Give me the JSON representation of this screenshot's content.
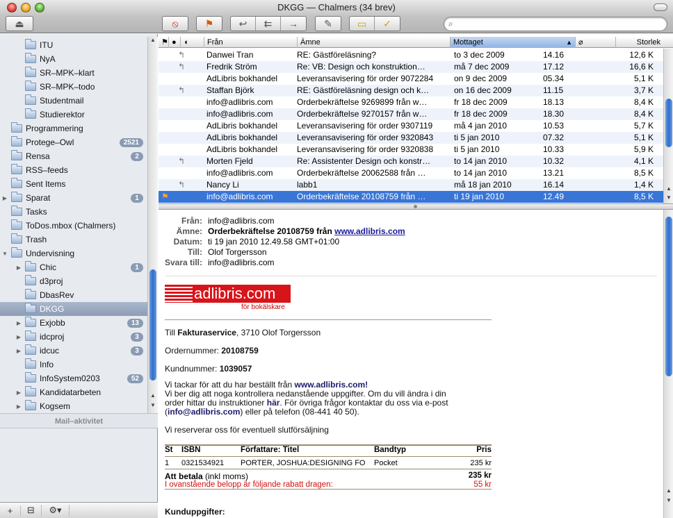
{
  "window": {
    "title": "DKGG — Chalmers (34 brev)"
  },
  "toolbar": {
    "search_placeholder": ""
  },
  "sidebar": {
    "items": [
      {
        "label": "ITU",
        "badge": "",
        "indent": 2,
        "tri": "",
        "sel": false
      },
      {
        "label": "NyA",
        "badge": "",
        "indent": 2,
        "tri": "",
        "sel": false
      },
      {
        "label": "SR–MPK–klart",
        "badge": "",
        "indent": 2,
        "tri": "",
        "sel": false
      },
      {
        "label": "SR–MPK–todo",
        "badge": "",
        "indent": 2,
        "tri": "",
        "sel": false
      },
      {
        "label": "Studentmail",
        "badge": "",
        "indent": 2,
        "tri": "",
        "sel": false
      },
      {
        "label": "Studierektor",
        "badge": "",
        "indent": 2,
        "tri": "",
        "sel": false
      },
      {
        "label": "Programmering",
        "badge": "",
        "indent": 1,
        "tri": "",
        "sel": false
      },
      {
        "label": "Protege–Owl",
        "badge": "2521",
        "indent": 1,
        "tri": "",
        "sel": false
      },
      {
        "label": "Rensa",
        "badge": "2",
        "indent": 1,
        "tri": "",
        "sel": false
      },
      {
        "label": "RSS–feeds",
        "badge": "",
        "indent": 1,
        "tri": "",
        "sel": false
      },
      {
        "label": "Sent Items",
        "badge": "",
        "indent": 1,
        "tri": "",
        "sel": false
      },
      {
        "label": "Sparat",
        "badge": "1",
        "indent": 1,
        "tri": "▶",
        "sel": false
      },
      {
        "label": "Tasks",
        "badge": "",
        "indent": 1,
        "tri": "",
        "sel": false
      },
      {
        "label": "ToDos.mbox (Chalmers)",
        "badge": "",
        "indent": 1,
        "tri": "",
        "sel": false
      },
      {
        "label": "Trash",
        "badge": "",
        "indent": 1,
        "tri": "",
        "sel": false
      },
      {
        "label": "Undervisning",
        "badge": "",
        "indent": 1,
        "tri": "▼",
        "sel": false
      },
      {
        "label": "Chic",
        "badge": "1",
        "indent": 2,
        "tri": "▶",
        "sel": false
      },
      {
        "label": "d3proj",
        "badge": "",
        "indent": 2,
        "tri": "",
        "sel": false
      },
      {
        "label": "DbasRev",
        "badge": "",
        "indent": 2,
        "tri": "",
        "sel": false
      },
      {
        "label": "DKGG",
        "badge": "",
        "indent": 2,
        "tri": "",
        "sel": true
      },
      {
        "label": "Exjobb",
        "badge": "13",
        "indent": 2,
        "tri": "▶",
        "sel": false
      },
      {
        "label": "idcproj",
        "badge": "3",
        "indent": 2,
        "tri": "▶",
        "sel": false
      },
      {
        "label": "idcuc",
        "badge": "3",
        "indent": 2,
        "tri": "▶",
        "sel": false
      },
      {
        "label": "Info",
        "badge": "",
        "indent": 2,
        "tri": "",
        "sel": false
      },
      {
        "label": "InfoSystem0203",
        "badge": "52",
        "indent": 2,
        "tri": "",
        "sel": false
      },
      {
        "label": "Kandidatarbeten",
        "badge": "",
        "indent": 2,
        "tri": "▶",
        "sel": false
      },
      {
        "label": "Kogsem",
        "badge": "",
        "indent": 2,
        "tri": "▶",
        "sel": false
      }
    ],
    "activity_label": "Mail–aktivitet"
  },
  "list": {
    "columns": {
      "from": "Från",
      "subject": "Ämne",
      "received": "Mottaget",
      "size": "Storlek"
    },
    "rows": [
      {
        "icon": "↰",
        "from": "Danwei Tran",
        "subject": "RE: Gästföreläsning?",
        "date": "to 3 dec 2009",
        "time": "14.16",
        "size": "12,6 K"
      },
      {
        "icon": "↰",
        "from": "Fredrik Ström",
        "subject": "Re: VB: Design och konstruktion…",
        "date": "må 7 dec 2009",
        "time": "17.12",
        "size": "16,6 K"
      },
      {
        "icon": "",
        "from": "AdLibris bokhandel",
        "subject": "Leveransavisering för order 9072284",
        "date": "on 9 dec 2009",
        "time": "05.34",
        "size": "5,1 K"
      },
      {
        "icon": "↰",
        "from": "Staffan Björk",
        "subject": "RE: Gästföreläsning design och k…",
        "date": "on 16 dec 2009",
        "time": "11.15",
        "size": "3,7 K"
      },
      {
        "icon": "",
        "from": "info@adlibris.com",
        "subject": "Orderbekräftelse 9269899 från w…",
        "date": "fr 18 dec 2009",
        "time": "18.13",
        "size": "8,4 K"
      },
      {
        "icon": "",
        "from": "info@adlibris.com",
        "subject": "Orderbekräftelse 9270157 från w…",
        "date": "fr 18 dec 2009",
        "time": "18.30",
        "size": "8,4 K"
      },
      {
        "icon": "",
        "from": "AdLibris bokhandel",
        "subject": "Leveransavisering för order 9307119",
        "date": "må 4 jan 2010",
        "time": "10.53",
        "size": "5,7 K"
      },
      {
        "icon": "",
        "from": "AdLibris bokhandel",
        "subject": "Leveransavisering för order 9320843",
        "date": "ti 5 jan 2010",
        "time": "07.32",
        "size": "5,1 K"
      },
      {
        "icon": "",
        "from": "AdLibris bokhandel",
        "subject": "Leveransavisering för order 9320838",
        "date": "ti 5 jan 2010",
        "time": "10.33",
        "size": "5,9 K"
      },
      {
        "icon": "↰",
        "from": "Morten Fjeld",
        "subject": "Re: Assistenter Design och konstr…",
        "date": "to 14 jan 2010",
        "time": "10.32",
        "size": "4,1 K"
      },
      {
        "icon": "",
        "from": "info@adlibris.com",
        "subject": "Orderbekräftelse 20062588 från …",
        "date": "to 14 jan 2010",
        "time": "13.21",
        "size": "8,5 K"
      },
      {
        "icon": "↰",
        "from": "Nancy Li",
        "subject": "labb1",
        "date": "må 18 jan 2010",
        "time": "16.14",
        "size": "1,4 K"
      },
      {
        "icon": "⚑",
        "from": "info@adlibris.com",
        "subject": "Orderbekräftelse 20108759 från …",
        "date": "ti 19 jan 2010",
        "time": "12.49",
        "size": "8,5 K"
      }
    ]
  },
  "message": {
    "headers": {
      "from_k": "Från:",
      "from_v": "info@adlibris.com",
      "subj_k": "Ämne:",
      "subj_v": "Orderbekräftelse 20108759 från ",
      "subj_link": "www.adlibris.com",
      "date_k": "Datum:",
      "date_v": "ti 19 jan 2010 12.49.58 GMT+01:00",
      "to_k": "Till:",
      "to_v": "Olof Torgersson",
      "reply_k": "Svara till:",
      "reply_v": "info@adlibris.com"
    },
    "logo": {
      "text": "adlibris.com",
      "tagline": "för bokälskare"
    },
    "body": {
      "l1a": "Till ",
      "l1b": "Fakturaservice",
      ", l1c": "",
      "l1rest": ", 3710 Olof Torgersson",
      "order_k": "Ordernummer: ",
      "order_v": "20108759",
      "cust_k": "Kundnummer: ",
      "cust_v": "1039057",
      "p1a": "Vi tackar för att du har beställt från ",
      "p1b": "www.adlibris.com",
      "p1c": "!",
      "p2": "Vi ber dig att noga kontrollera nedanstående uppgifter. Om du vill ändra i din",
      "p3a": "order hittar du instruktioner ",
      "p3b": "här",
      ". p3c": "",
      "p3rest": ". För övriga frågor kontaktar du oss via e-post",
      "p4a": "(",
      "p4b": "info@adlibris.com",
      "p4c": ") eller på telefon (08-441 40 50).",
      "p5": "Vi reserverar oss för eventuell slutförsäljning",
      "table": {
        "h_st": "St",
        "h_isbn": "ISBN",
        "h_auth": "Författare: Titel",
        "h_band": "Bandtyp",
        "h_price": "Pris",
        "r_st": "1",
        "r_isbn": "0321534921",
        "r_auth": "PORTER, JOSHUA:DESIGNING FO",
        "r_band": "Pocket",
        "r_price": "235 kr",
        "tot_k": "Att betala",
        "tot_k2": " (inkl moms)",
        "tot_v": "235 kr",
        "disc_k": "I ovanstående belopp är följande rabatt dragen:",
        "disc_v": "55 kr"
      },
      "cust_title": "Kunduppgifter:"
    }
  }
}
